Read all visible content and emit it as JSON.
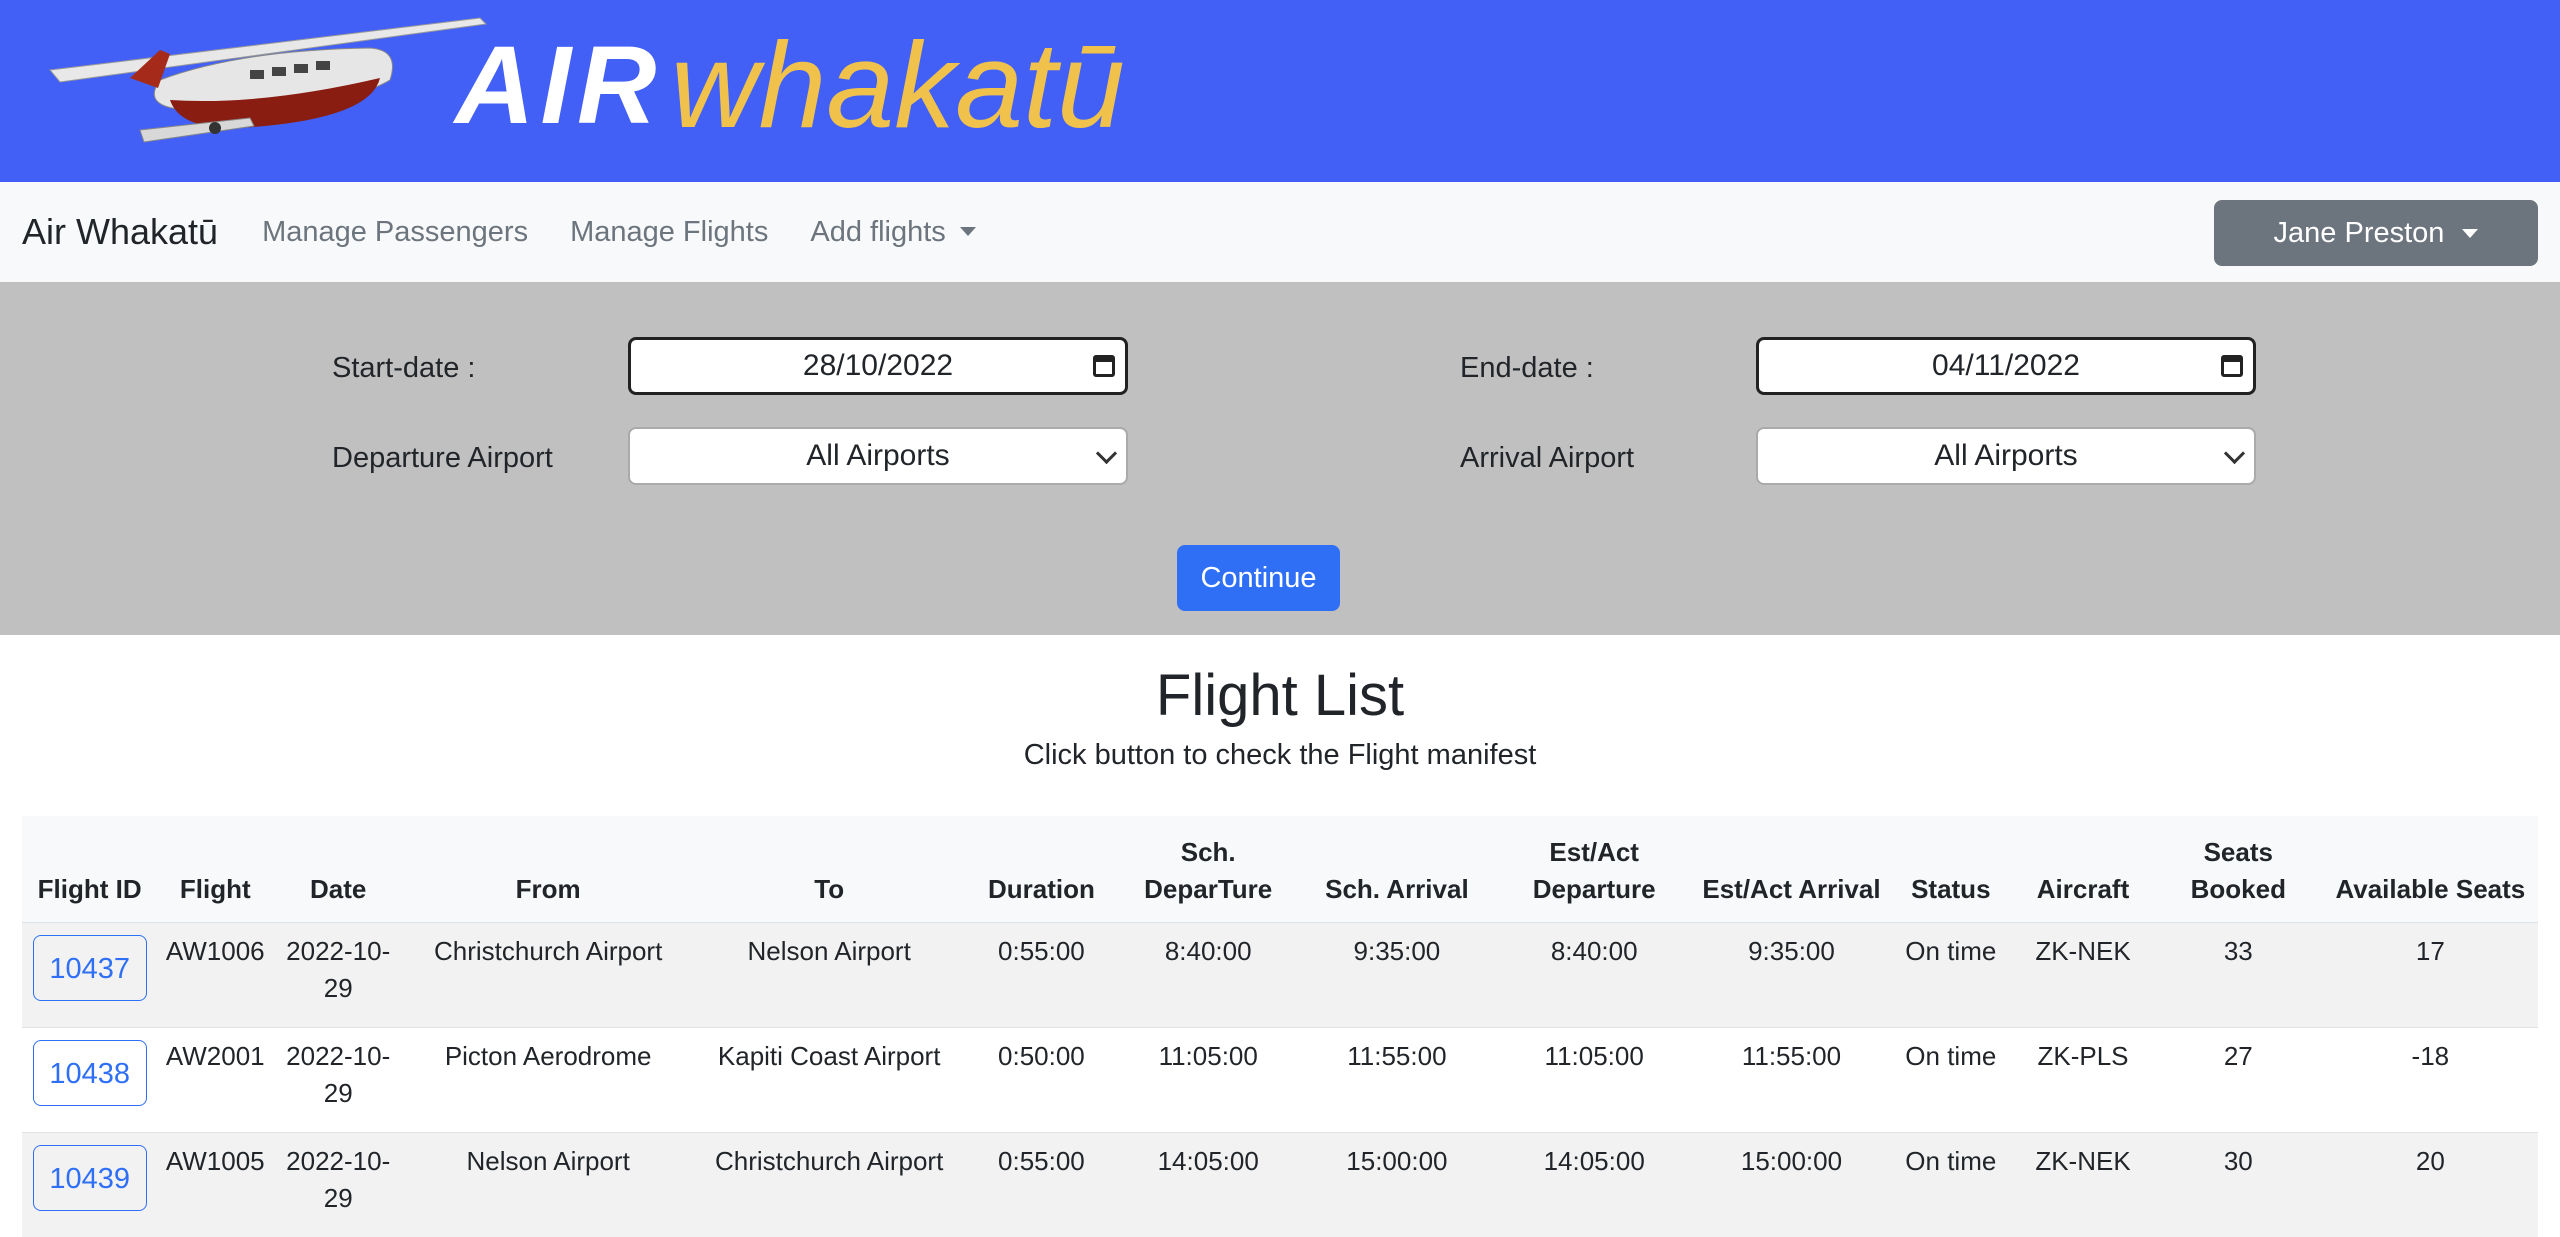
{
  "banner": {
    "logo_air": "AIR",
    "logo_rest": "whakatū"
  },
  "nav": {
    "brand": "Air Whakatū",
    "links": [
      "Manage Passengers",
      "Manage Flights",
      "Add flights"
    ],
    "user": "Jane Preston"
  },
  "filters": {
    "start_label": "Start-date :",
    "start_value": "28/10/2022",
    "end_label": "End-date :",
    "end_value": "04/11/2022",
    "dep_label": "Departure Airport",
    "dep_value": "All Airports",
    "arr_label": "Arrival Airport",
    "arr_value": "All Airports",
    "continue": "Continue"
  },
  "main": {
    "title": "Flight List",
    "subtitle": "Click button to check the Flight manifest"
  },
  "table": {
    "headers": [
      "Flight ID",
      "Flight",
      "Date",
      "From",
      "To",
      "Duration",
      "Sch. DeparTure",
      "Sch. Arrival",
      "Est/Act Departure",
      "Est/Act Arrival",
      "Status",
      "Aircraft",
      "Seats Booked",
      "Available Seats"
    ],
    "rows": [
      [
        "10437",
        "AW1006",
        "2022-10-29",
        "Christchurch Airport",
        "Nelson Airport",
        "0:55:00",
        "8:40:00",
        "9:35:00",
        "8:40:00",
        "9:35:00",
        "On time",
        "ZK-NEK",
        "33",
        "17"
      ],
      [
        "10438",
        "AW2001",
        "2022-10-29",
        "Picton Aerodrome",
        "Kapiti Coast Airport",
        "0:50:00",
        "11:05:00",
        "11:55:00",
        "11:05:00",
        "11:55:00",
        "On time",
        "ZK-PLS",
        "27",
        "-18"
      ],
      [
        "10439",
        "AW1005",
        "2022-10-29",
        "Nelson Airport",
        "Christchurch Airport",
        "0:55:00",
        "14:05:00",
        "15:00:00",
        "14:05:00",
        "15:00:00",
        "On time",
        "ZK-NEK",
        "30",
        "20"
      ]
    ]
  }
}
